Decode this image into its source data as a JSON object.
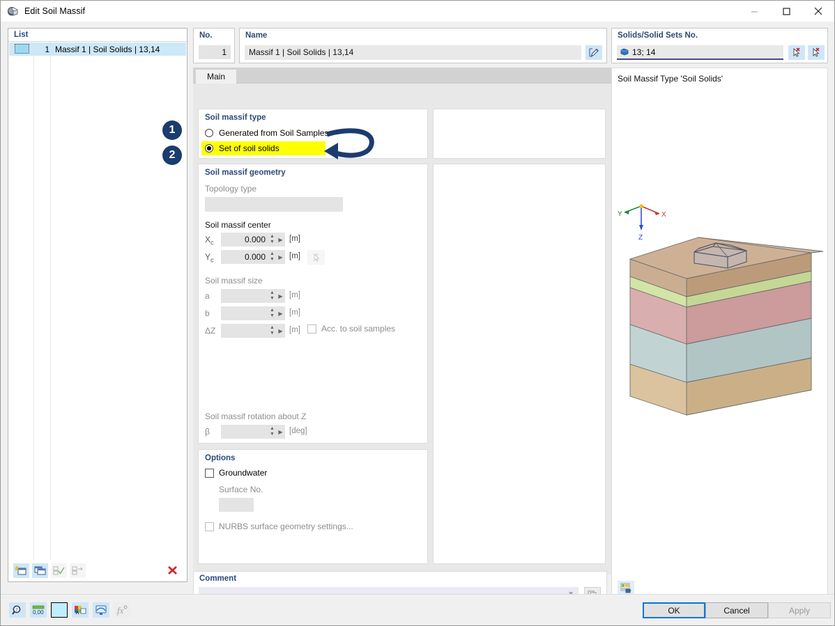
{
  "window": {
    "title": "Edit Soil Massif",
    "icon": "soil-massif-icon",
    "minimize": "–",
    "maximize": "□",
    "close": "✕"
  },
  "left_panel": {
    "header": "List",
    "rows": [
      {
        "num": "1",
        "label": "Massif 1 | Soil Solids | 13,14"
      }
    ],
    "toolbar": [
      {
        "name": "new-item-button",
        "glyph": "new"
      },
      {
        "name": "copy-item-button",
        "glyph": "copy"
      },
      {
        "name": "select-all-button",
        "glyph": "check"
      },
      {
        "name": "invert-selection-button",
        "glyph": "invert"
      },
      {
        "name": "delete-item-button",
        "glyph": "✕"
      }
    ]
  },
  "header": {
    "no_label": "No.",
    "no_value": "1",
    "name_label": "Name",
    "name_value": "Massif 1 | Soil Solids | 13,14",
    "name_placeholder": "",
    "name_edit_button": "edit-name-button",
    "solids_label": "Solids/Solid Sets No.",
    "solids_value": "13; 14",
    "solids_pick_button": "pick-solids-button",
    "solids_deselect_button": "deselect-solids-button"
  },
  "tabs": [
    {
      "label": "Main",
      "active": true
    }
  ],
  "soil_massif_type": {
    "title": "Soil massif type",
    "options": [
      {
        "label": "Generated from Soil Samples",
        "selected": false,
        "highlighted": false
      },
      {
        "label": "Set of soil solids",
        "selected": true,
        "highlighted": true
      }
    ]
  },
  "soil_massif_geometry": {
    "title": "Soil massif geometry",
    "topology_label": "Topology type",
    "topology_value": "",
    "center_label": "Soil massif center",
    "center": [
      {
        "symbol": "X",
        "sub": "c",
        "value": "0.000",
        "unit": "[m]"
      },
      {
        "symbol": "Y",
        "sub": "c",
        "value": "0.000",
        "unit": "[m]"
      }
    ],
    "center_pick_button": "pick-center-button",
    "size_label": "Soil massif size",
    "size": [
      {
        "symbol": "a",
        "sub": "",
        "value": "",
        "unit": "[m]"
      },
      {
        "symbol": "b",
        "sub": "",
        "value": "",
        "unit": "[m]"
      },
      {
        "symbol": "ΔZ",
        "sub": "",
        "value": "",
        "unit": "[m]"
      }
    ],
    "acc_checkbox_label": "Acc. to soil samples",
    "acc_checked": false,
    "rotation_label": "Soil massif rotation about Z",
    "rotation": {
      "symbol": "β",
      "value": "",
      "unit": "[deg]"
    }
  },
  "options": {
    "title": "Options",
    "groundwater_label": "Groundwater",
    "groundwater_checked": false,
    "surface_no_label": "Surface No.",
    "surface_no_value": "",
    "nurbs_label": "NURBS surface geometry settings...",
    "nurbs_checked": false
  },
  "comment": {
    "title": "Comment",
    "value": "",
    "placeholder": "",
    "dropdown_icon": "chevron-down-icon",
    "library_button": "comment-library-button"
  },
  "preview": {
    "title": "Soil Massif Type 'Soil Solids'",
    "axes": [
      {
        "label": "X",
        "color": "#c0392b"
      },
      {
        "label": "Y",
        "color": "#1f8b3a"
      },
      {
        "label": "Z",
        "color": "#2a4fd6"
      }
    ],
    "settings_button": "preview-settings-button",
    "layers": [
      {
        "name": "topsoil",
        "color": "#c4a382"
      },
      {
        "name": "greenband",
        "color": "#cfe2a0"
      },
      {
        "name": "clay",
        "color": "#d4a3a3"
      },
      {
        "name": "silt",
        "color": "#b9cdcd"
      },
      {
        "name": "sand",
        "color": "#d6bd94"
      }
    ],
    "building_color": "#b8bdce"
  },
  "bottom_tools": [
    {
      "name": "find-button",
      "glyph": "search"
    },
    {
      "name": "units-button",
      "glyph": "0.00"
    },
    {
      "name": "color-button",
      "glyph": "swatch"
    },
    {
      "name": "display-properties-button",
      "glyph": "palette"
    },
    {
      "name": "view-button",
      "glyph": "monitor"
    },
    {
      "name": "formula-button",
      "glyph": "fx"
    }
  ],
  "dialog_buttons": {
    "ok": "OK",
    "cancel": "Cancel",
    "apply": "Apply"
  },
  "annotations": [
    {
      "id": "1",
      "text": "1"
    },
    {
      "id": "2",
      "text": "2"
    }
  ],
  "colors": {
    "accent": "#2b4a7a",
    "highlight": "#ffff00",
    "selection": "#cde8f7",
    "annotation": "#1b3c6e",
    "primary_button_border": "#0078d7"
  }
}
